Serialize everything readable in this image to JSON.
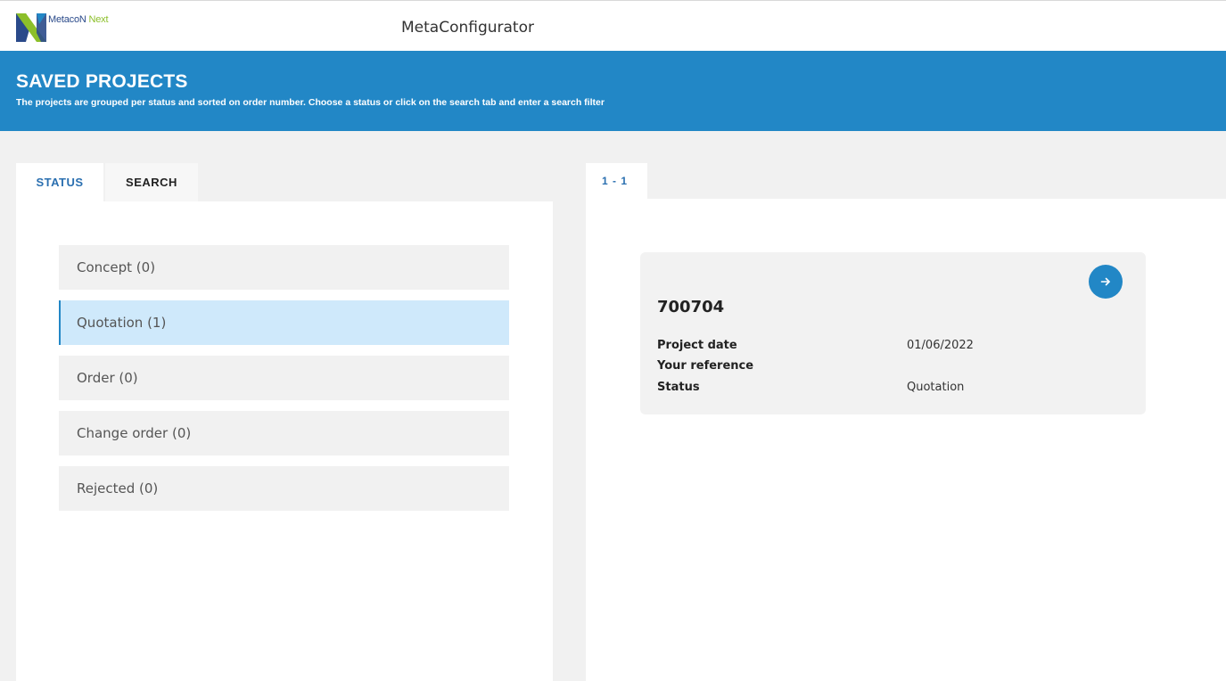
{
  "header": {
    "logo": {
      "text_a": "MetacoN",
      "text_b": " Next"
    },
    "app_title": "MetaConfigurator"
  },
  "banner": {
    "title": "SAVED PROJECTS",
    "subtitle": "The projects are grouped per status and sorted on order number. Choose a status or click on the search tab and enter a search filter"
  },
  "tabs": [
    {
      "label": "STATUS",
      "active": true
    },
    {
      "label": "SEARCH",
      "active": false
    }
  ],
  "statuses": [
    {
      "label": "Concept (0)",
      "active": false
    },
    {
      "label": "Quotation (1)",
      "active": true
    },
    {
      "label": "Order (0)",
      "active": false
    },
    {
      "label": "Change order (0)",
      "active": false
    },
    {
      "label": "Rejected (0)",
      "active": false
    }
  ],
  "pagination": {
    "label": "1 - 1"
  },
  "project": {
    "number": "700704",
    "fields": [
      {
        "label": "Project date",
        "value": "01/06/2022"
      },
      {
        "label": "Your reference",
        "value": ""
      },
      {
        "label": "Status",
        "value": "Quotation"
      }
    ]
  },
  "colors": {
    "accent": "#2287c6",
    "active_status_bg": "#cfe9fb",
    "page_bg": "#f1f1f1"
  },
  "icons": {
    "logo": "metacon-logo-icon",
    "open_project": "arrow-right-icon"
  }
}
